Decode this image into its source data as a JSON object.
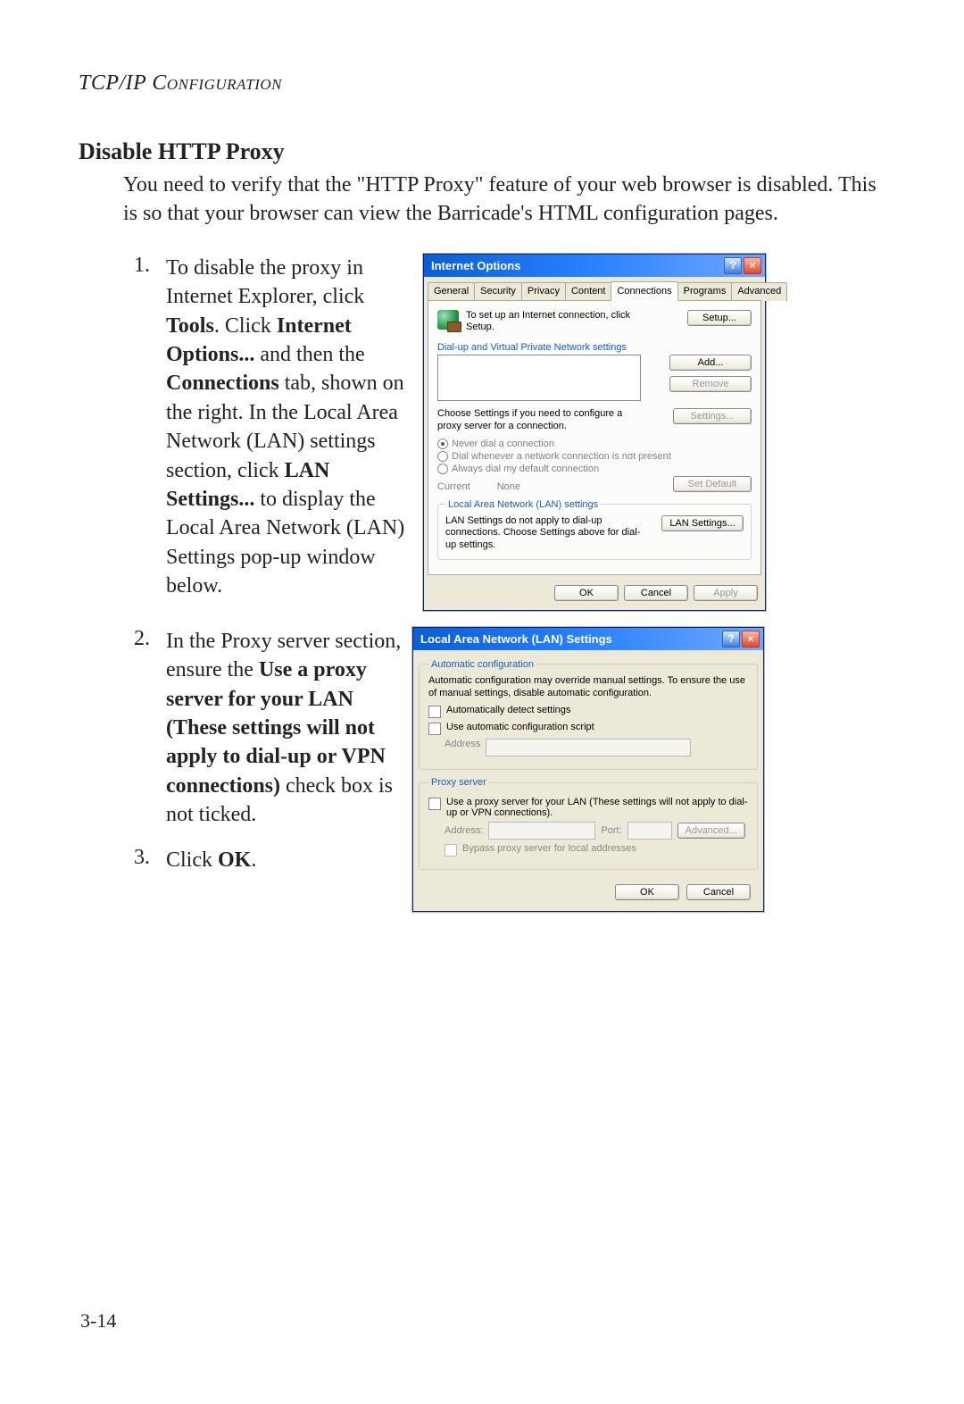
{
  "page_header": "TCP/IP Configuration",
  "section_title": "Disable HTTP Proxy",
  "intro": "You need to verify that the \"HTTP Proxy\" feature of your web browser is disabled. This is so that your browser can view the Barricade's HTML configuration pages.",
  "steps": {
    "s1": {
      "num": "1.",
      "pre": "To disable the proxy in Internet Explorer, click ",
      "b1": "Tools",
      "mid1": ". Click ",
      "b2": "Internet Options...",
      "mid2": " and then the ",
      "b3": "Connections",
      "mid3": " tab, shown on the right. In the Local Area Network (LAN) settings section, click ",
      "b4": "LAN Settings...",
      "post": " to display the Local Area Network (LAN) Settings pop-up window below."
    },
    "s2": {
      "num": "2.",
      "pre": "In the Proxy server section, ensure the ",
      "b1": "Use a proxy server for your LAN (These settings will not apply to dial-up or VPN connections)",
      "post": " check box is not ticked."
    },
    "s3": {
      "num": "3.",
      "pre": "Click ",
      "b1": "OK",
      "post": "."
    }
  },
  "io": {
    "title": "Internet Options",
    "tabs": [
      "General",
      "Security",
      "Privacy",
      "Content",
      "Connections",
      "Programs",
      "Advanced"
    ],
    "setup_text_1": "To set up an Internet connection, click",
    "setup_text_2": "Setup.",
    "setup_btn": "Setup...",
    "dial_label": "Dial-up and Virtual Private Network settings",
    "add_btn": "Add...",
    "remove_btn": "Remove",
    "settings_note": "Choose Settings if you need to configure a proxy server for a connection.",
    "settings_btn": "Settings...",
    "radio1": "Never dial a connection",
    "radio2": "Dial whenever a network connection is not present",
    "radio3": "Always dial my default connection",
    "current_label": "Current",
    "current_value": "None",
    "setdefault_btn": "Set Default",
    "lan_legend": "Local Area Network (LAN) settings",
    "lan_note": "LAN Settings do not apply to dial-up connections. Choose Settings above for dial-up settings.",
    "lan_btn": "LAN Settings...",
    "ok": "OK",
    "cancel": "Cancel",
    "apply": "Apply"
  },
  "lan": {
    "title": "Local Area Network (LAN) Settings",
    "auto_legend": "Automatic configuration",
    "auto_note": "Automatic configuration may override manual settings.  To ensure the use of manual settings, disable automatic configuration.",
    "chk_detect": "Automatically detect settings",
    "chk_script": "Use automatic configuration script",
    "address_label": "Address",
    "proxy_legend": "Proxy server",
    "proxy_chk": "Use a proxy server for your LAN (These settings will not apply to dial-up or VPN connections).",
    "addr2_label": "Address:",
    "port_label": "Port:",
    "advanced_btn": "Advanced...",
    "bypass": "Bypass proxy server for local addresses",
    "ok": "OK",
    "cancel": "Cancel"
  },
  "page_num": "3-14"
}
